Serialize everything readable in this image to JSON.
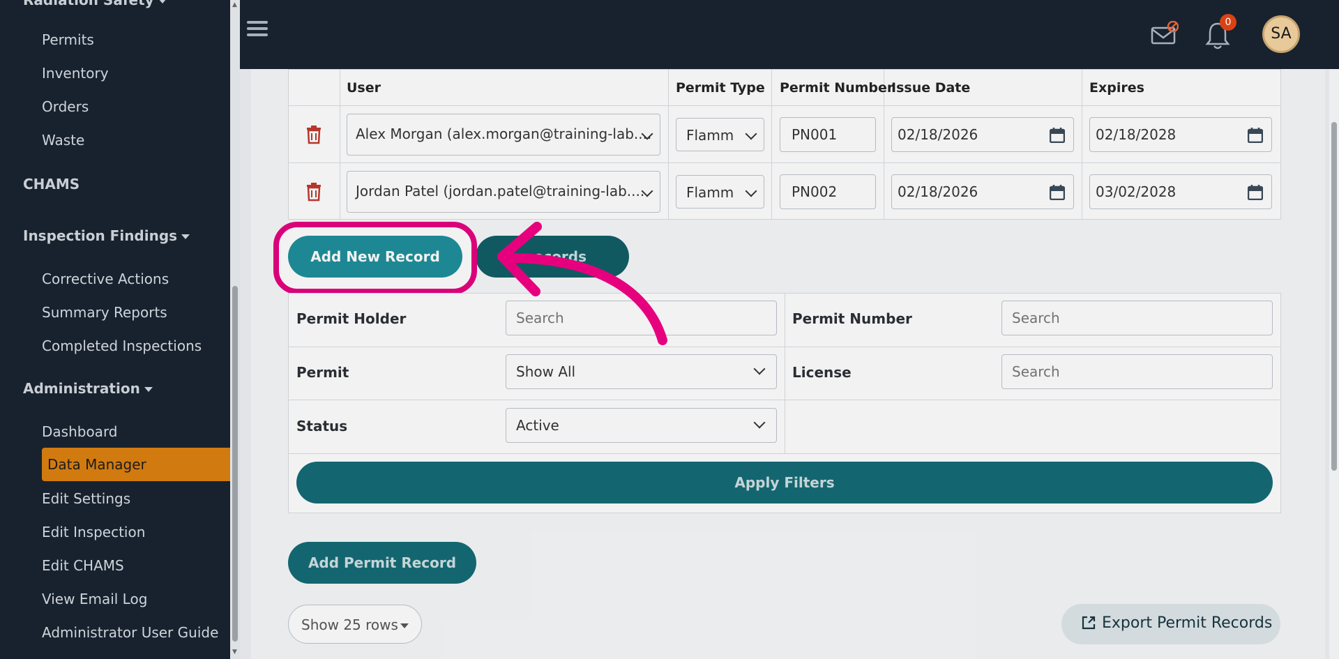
{
  "sidebar": {
    "top_section": "Radiation Safety",
    "rad_items": [
      "Permits",
      "Inventory",
      "Orders",
      "Waste"
    ],
    "chams": "CHAMS",
    "inspection_findings": "Inspection Findings",
    "inspection_items": [
      "Corrective Actions",
      "Summary Reports",
      "Completed Inspections"
    ],
    "administration": "Administration",
    "admin_items": [
      "Dashboard",
      "Data Manager",
      "Edit Settings",
      "Edit Inspection",
      "Edit CHAMS",
      "View Email Log",
      "Administrator User Guide"
    ],
    "active_item": "Data Manager"
  },
  "topbar": {
    "notification_count": "0",
    "avatar_initials": "SA"
  },
  "table": {
    "columns": [
      "User",
      "Permit Type",
      "Permit Number",
      "Issue Date",
      "Expires"
    ],
    "rows": [
      {
        "user": "Alex Morgan (alex.morgan@training-lab....",
        "permit_type": "Flamm",
        "permit_number": "PN001",
        "issue_date": "02/18/2026",
        "expires": "02/18/2028"
      },
      {
        "user": "Jordan Patel (jordan.patel@training-lab....",
        "permit_type": "Flamm",
        "permit_number": "PN002",
        "issue_date": "02/18/2026",
        "expires": "03/02/2028"
      }
    ]
  },
  "buttons": {
    "add_new_record": "Add New Record",
    "second_visible": "...ecords",
    "apply_filters": "Apply Filters",
    "add_permit_record": "Add Permit Record",
    "show_rows": "Show 25 rows",
    "export": "Export Permit Records"
  },
  "filters": {
    "permit_holder_label": "Permit Holder",
    "permit_holder_placeholder": "Search",
    "permit_number_label": "Permit Number",
    "permit_number_placeholder": "Search",
    "permit_label": "Permit",
    "permit_value": "Show All",
    "license_label": "License",
    "license_placeholder": "Search",
    "status_label": "Status",
    "status_value": "Active"
  },
  "colors": {
    "sidebar_bg": "#18222e",
    "accent_teal": "#136b73",
    "active_orange": "#d17a10",
    "highlight_pink": "#e6007e"
  }
}
